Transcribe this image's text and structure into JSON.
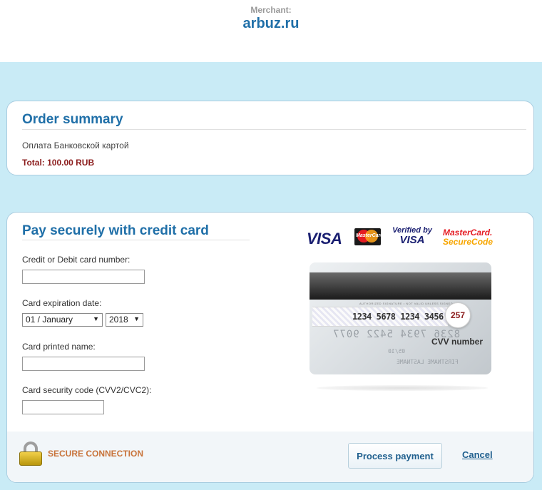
{
  "merchant": {
    "label": "Merchant:",
    "name": "arbuz.ru"
  },
  "order": {
    "title": "Order summary",
    "description": "Оплата Банковской картой",
    "total": "Total: 100.00 RUB"
  },
  "payment": {
    "title": "Pay securely with credit card",
    "fields": {
      "card_number_label": "Credit or Debit card number:",
      "card_number_value": "",
      "expiration_label": "Card expiration date:",
      "expiration_month": "01 / January",
      "expiration_year": "2018",
      "name_label": "Card printed name:",
      "name_value": "",
      "security_label": "Card security code (CVV2/CVC2):",
      "security_value": ""
    },
    "logos": {
      "visa": "VISA",
      "mastercard": "MasterCard",
      "verified_top": "Verified by",
      "verified_bottom": "VISA",
      "securecode_top": "MasterCard.",
      "securecode_bottom": "SecureCode"
    },
    "card_illustration": {
      "auth_text": "AUTHORIZED SIGNATURE • NOT VALID UNLESS SIGNED",
      "signature_number": "1234 5678 1234 3456",
      "cvv_value": "257",
      "cvv_label": "CVV number",
      "embossed_number": "8236 7934 5422 9077",
      "embossed_date": "05/10",
      "embossed_name": "FIRSTNAME LASTNAME"
    }
  },
  "footer": {
    "secure_label": "SECURE CONNECTION",
    "process_button": "Process payment",
    "cancel_link": "Cancel"
  },
  "colors": {
    "page_background": "#c9ebf6",
    "heading_blue": "#1f6fa8",
    "total_red": "#8b1c1c",
    "secure_orange": "#c8733a"
  }
}
